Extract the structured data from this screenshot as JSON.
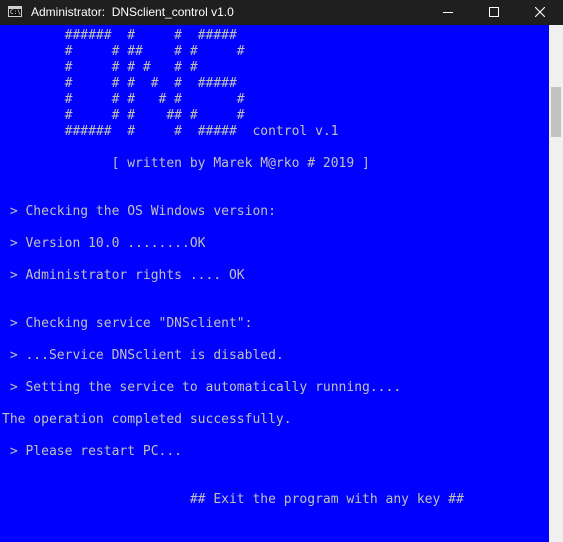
{
  "window": {
    "title": "Administrator:  DNSclient_control v1.0",
    "app_icon_text": "C:\\",
    "controls": {
      "minimize": "minimize",
      "maximize": "maximize",
      "close": "close"
    }
  },
  "console": {
    "lines": [
      "        ######  #     #  #####",
      "        #     # ##    # #     #",
      "        #     # # #   # #",
      "        #     # #  #  #  #####",
      "        #     # #   # #       #",
      "        #     # #    ## #     #",
      "        ######  #     #  #####  control v.1",
      "",
      "              [ written by Marek M@rko # 2019 ]",
      "",
      "",
      " > Checking the OS Windows version:",
      "",
      " > Version 10.0 ........OK",
      "",
      " > Administrator rights .... OK",
      "",
      "",
      " > Checking service \"DNSclient\":",
      "",
      " > ...Service DNSclient is disabled.",
      "",
      " > Setting the service to automatically running....",
      "",
      "The operation completed successfully.",
      "",
      " > Please restart PC...",
      "",
      "",
      "                        ## Exit the program with any key ##"
    ]
  },
  "colors": {
    "console_background": "#0000ff",
    "console_text": "#c0c0c0",
    "titlebar": "#1f1f1f"
  }
}
